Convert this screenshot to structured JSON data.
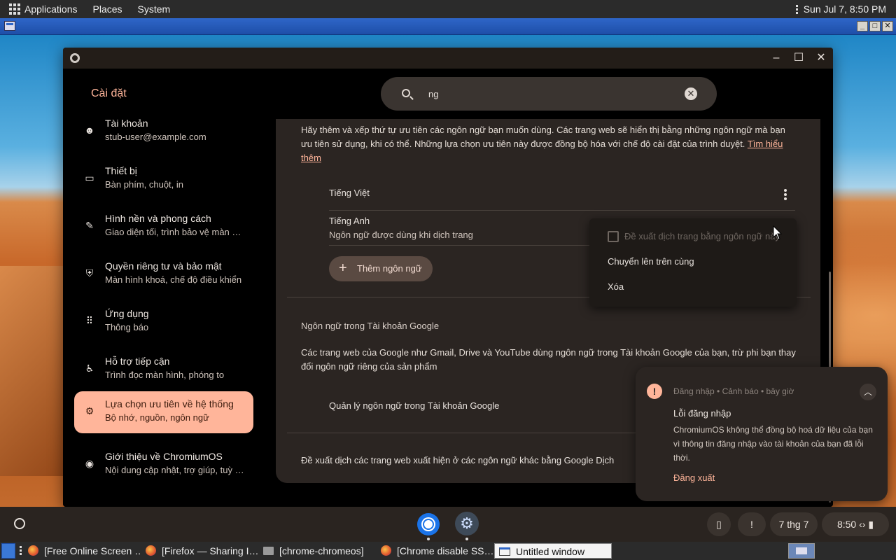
{
  "gnome_top": {
    "menus": [
      "Applications",
      "Places",
      "System"
    ],
    "clock": "Sun Jul  7, 8:50 PM"
  },
  "settings": {
    "app_title": "Cài đặt",
    "search": {
      "value": "ng",
      "placeholder": ""
    },
    "sidebar": [
      {
        "title": "Tài khoản",
        "subtitle": "stub-user@example.com",
        "icon": "account-icon"
      },
      {
        "title": "Thiết bị",
        "subtitle": "Bàn phím, chuột, in",
        "icon": "laptop-icon"
      },
      {
        "title": "Hình nền và phong cách",
        "subtitle": "Giao diện tối, trình bảo vệ màn …",
        "icon": "paintbrush-icon"
      },
      {
        "title": "Quyền riêng tư và bảo mật",
        "subtitle": "Màn hình khoá, chế độ điều khiển",
        "icon": "shield-icon"
      },
      {
        "title": "Ứng dụng",
        "subtitle": "Thông báo",
        "icon": "apps-grid-icon"
      },
      {
        "title": "Hỗ trợ tiếp cận",
        "subtitle": "Trình đọc màn hình, phóng to",
        "icon": "accessibility-icon"
      },
      {
        "title": "Lựa chọn ưu tiên về hệ thống",
        "subtitle": "Bộ nhớ, nguồn, ngôn ngữ",
        "icon": "gear-icon",
        "active": true
      },
      {
        "title": "Giới thiệu về ChromiumOS",
        "subtitle": "Nội dung cập nhật, trợ giúp, tuỳ …",
        "icon": "chromium-icon"
      }
    ],
    "content": {
      "intro": "Hãy thêm và xếp thứ tự ưu tiên các ngôn ngữ bạn muốn dùng. Các trang web sẽ hiển thị bằng những ngôn ngữ mà bạn ưu tiên sử dụng, khi có thể. Những lựa chọn ưu tiên này được đồng bộ hóa với chế độ cài đặt của trình duyệt.",
      "learn_more": "Tìm hiểu thêm",
      "languages": [
        {
          "name": "Tiếng Việt",
          "note": ""
        },
        {
          "name": "Tiếng Anh",
          "note": "Ngôn ngữ được dùng khi dịch trang"
        }
      ],
      "add_language": "Thêm ngôn ngữ",
      "google_section_title": "Ngôn ngữ trong Tài khoản Google",
      "google_desc": "Các trang web của Google như Gmail, Drive và YouTube dùng ngôn ngữ trong Tài khoản Google của bạn, trừ phi bạn thay đổi ngôn ngữ riêng của sản phẩm",
      "manage_google": "Quản lý ngôn ngữ trong Tài khoản Google",
      "suggest_translate": "Đề xuất dịch các trang web xuất hiện ở các ngôn ngữ khác bằng Google Dịch"
    },
    "context_menu": {
      "offer_translate": "Đề xuất dịch trang bằng ngôn ngữ này",
      "move_top": "Chuyển lên trên cùng",
      "remove": "Xóa"
    }
  },
  "notification": {
    "meta": "Đăng nhập • Cảnh báo • bây giờ",
    "title": "Lỗi đăng nhập",
    "body": "ChromiumOS không thể đồng bộ hoá dữ liệu của bạn vì thông tin đăng nhập vào tài khoản của bạn đã lỗi thời.",
    "action": "Đăng xuất"
  },
  "shelf": {
    "date": "7 thg 7",
    "time": "8:50"
  },
  "taskbar": [
    {
      "label": "[Free Online Screen …",
      "icon": "firefox-icon"
    },
    {
      "label": "[Firefox — Sharing I…",
      "icon": "firefox-icon"
    },
    {
      "label": "[chrome-chromeos]",
      "icon": "folder-icon"
    },
    {
      "label": "[Chrome disable SS…",
      "icon": "firefox-icon"
    },
    {
      "label": "Untitled window",
      "icon": "window-icon",
      "active": true
    }
  ],
  "colors": {
    "accent": "#ffb59a",
    "panel": "#2b2b2b",
    "card": "#2b2522"
  }
}
